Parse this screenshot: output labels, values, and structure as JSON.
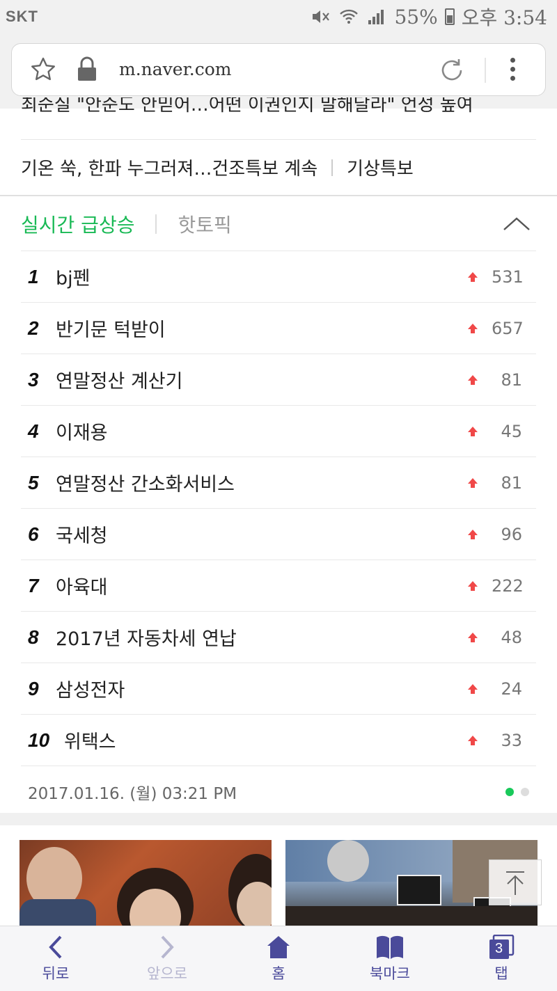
{
  "status_bar": {
    "carrier": "SKT",
    "battery": "55%",
    "time": "오후 3:54"
  },
  "browser": {
    "url": "m.naver.com"
  },
  "news": {
    "partial_headline": "최순실 \"안준도 안믿어…어떤 이권인지 말해달라\" 언성 높여",
    "headline": "기온 쑥, 한파 누그러져…건조특보 계속",
    "tag": "기상특보"
  },
  "realtime": {
    "tab_active": "실시간 급상승",
    "tab_other": "핫토픽",
    "items": [
      {
        "rank": "1",
        "term": "bj펜",
        "change": "531"
      },
      {
        "rank": "2",
        "term": "반기문 턱받이",
        "change": "657"
      },
      {
        "rank": "3",
        "term": "연말정산 계산기",
        "change": "81"
      },
      {
        "rank": "4",
        "term": "이재용",
        "change": "45"
      },
      {
        "rank": "5",
        "term": "연말정산 간소화서비스",
        "change": "81"
      },
      {
        "rank": "6",
        "term": "국세청",
        "change": "96"
      },
      {
        "rank": "7",
        "term": "아육대",
        "change": "222"
      },
      {
        "rank": "8",
        "term": "2017년 자동차세 연납",
        "change": "48"
      },
      {
        "rank": "9",
        "term": "삼성전자",
        "change": "24"
      },
      {
        "rank": "10",
        "term": "위택스",
        "change": "33"
      }
    ],
    "timestamp": "2017.01.16. (월) 03:21 PM",
    "page_count": 2,
    "active_page": 1
  },
  "nav": {
    "back": "뒤로",
    "forward": "앞으로",
    "home": "홈",
    "bookmark": "북마크",
    "tabs": "탭",
    "tab_count": "3"
  },
  "colors": {
    "accent_green": "#19b955",
    "up_red": "#f04848",
    "nav_purple": "#4a4a9a"
  }
}
